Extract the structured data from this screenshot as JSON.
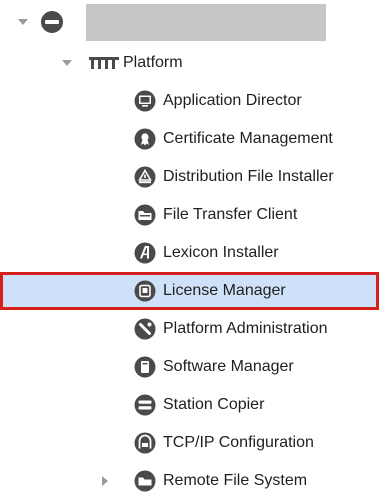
{
  "tree": {
    "root": {
      "label": "",
      "icon": "station-icon",
      "expanded": true,
      "label_redacted": true
    },
    "platform": {
      "label": "Platform",
      "icon": "platform-icon",
      "expanded": true
    },
    "children": [
      {
        "label": "Application Director",
        "icon": "monitor-icon"
      },
      {
        "label": "Certificate Management",
        "icon": "certificate-icon"
      },
      {
        "label": "Distribution File Installer",
        "icon": "distribution-icon"
      },
      {
        "label": "File Transfer Client",
        "icon": "file-transfer-icon"
      },
      {
        "label": "Lexicon Installer",
        "icon": "lexicon-icon"
      },
      {
        "label": "License Manager",
        "icon": "license-icon",
        "selected": true
      },
      {
        "label": "Platform Administration",
        "icon": "platform-admin-icon"
      },
      {
        "label": "Software Manager",
        "icon": "software-icon"
      },
      {
        "label": "Station Copier",
        "icon": "station-copier-icon"
      },
      {
        "label": "TCP/IP Configuration",
        "icon": "tcpip-icon"
      },
      {
        "label": "Remote File System",
        "icon": "remote-fs-icon",
        "expanded": false
      }
    ]
  },
  "colors": {
    "icon": "#4a4a4a",
    "selection_bg": "#cfe1f8",
    "selection_border": "#d6201c",
    "redacted": "#c6c6c6",
    "expander": "#9a9a9a"
  }
}
